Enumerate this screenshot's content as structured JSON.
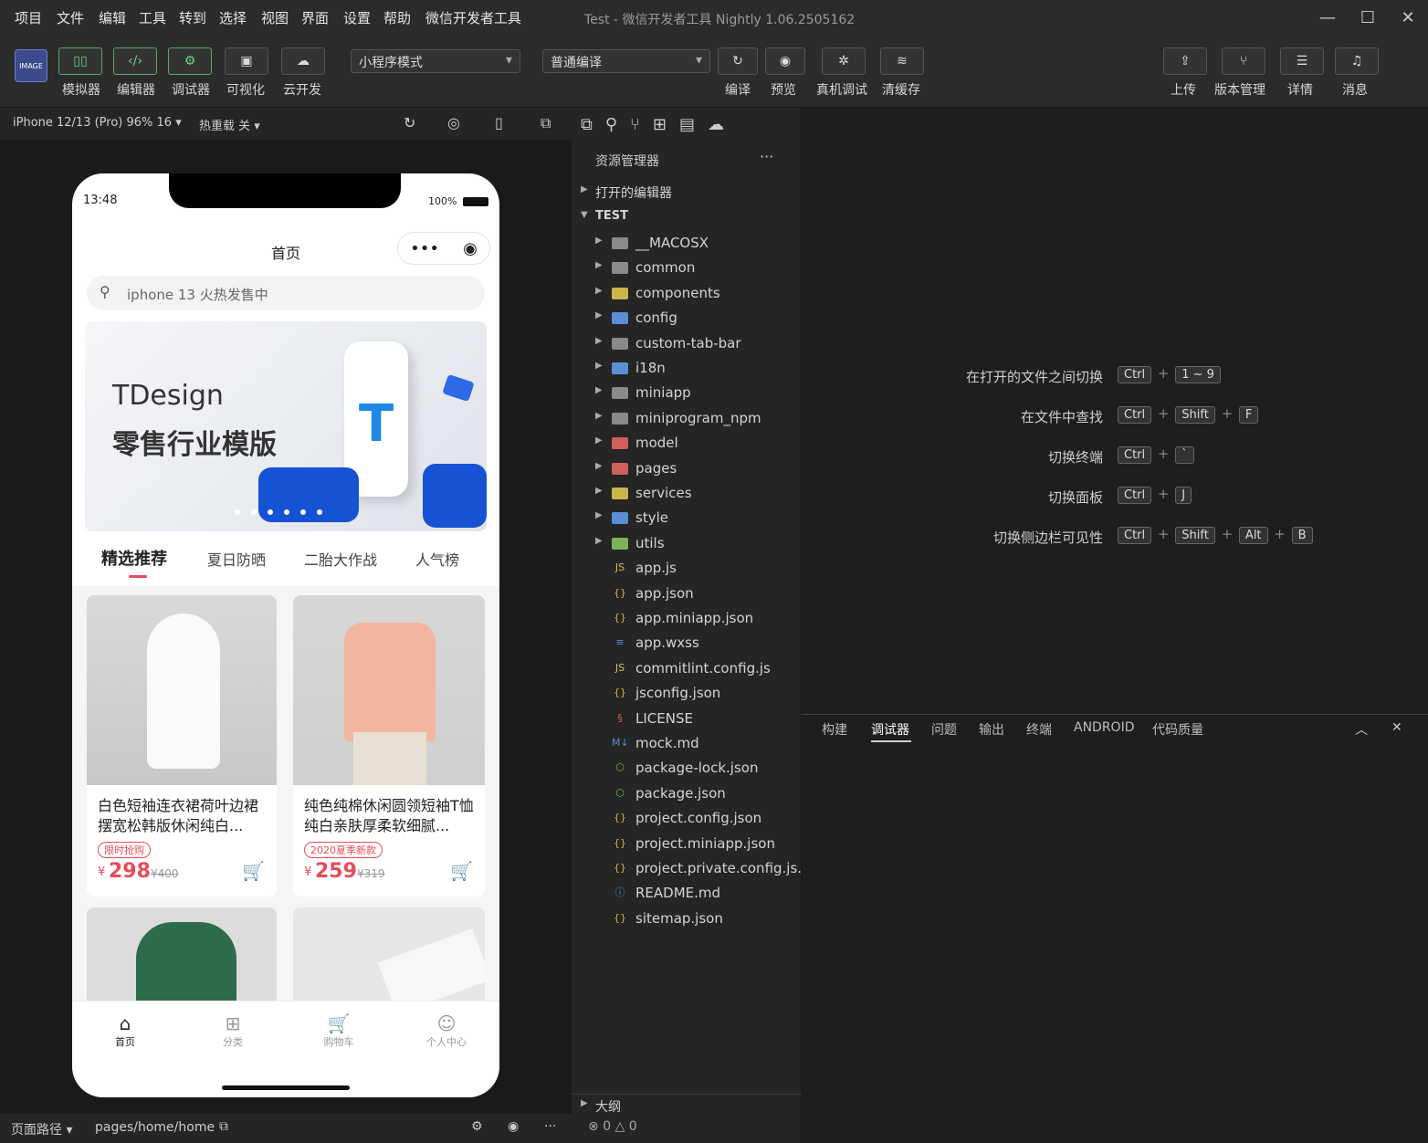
{
  "menu": [
    "项目",
    "文件",
    "编辑",
    "工具",
    "转到",
    "选择",
    "视图",
    "界面",
    "设置",
    "帮助",
    "微信开发者工具"
  ],
  "window_title": "Test - 微信开发者工具 Nightly 1.06.2505162",
  "toolbar": {
    "left_labels": [
      "模拟器",
      "编辑器",
      "调试器",
      "可视化",
      "云开发"
    ],
    "mode_select": "小程序模式",
    "compile_select": "普通编译",
    "mid_labels": [
      "编译",
      "预览",
      "真机调试",
      "清缓存"
    ],
    "right_labels": [
      "上传",
      "版本管理",
      "详情",
      "消息"
    ]
  },
  "simbar": {
    "device": "iPhone 12/13 (Pro) 96% 16",
    "hotreload": "热重载 关"
  },
  "phone": {
    "time": "13:48",
    "battery": "100%",
    "nav_title": "首页",
    "search_placeholder": "iphone 13 火热发售中",
    "banner_title": "TDesign",
    "banner_subtitle": "零售行业模版",
    "tabs": [
      "精选推荐",
      "夏日防晒",
      "二胎大作战",
      "人气榜"
    ],
    "products": [
      {
        "name": "白色短袖连衣裙荷叶边裙摆宽松韩版休闲纯白...",
        "tag": "限时抢购",
        "price": "298",
        "orig": "¥400"
      },
      {
        "name": "纯色纯棉休闲圆领短袖T恤纯白亲肤厚柔软细腻...",
        "tag": "2020夏季新款",
        "price": "259",
        "orig": "¥319"
      }
    ],
    "bottom_tabs": [
      "首页",
      "分类",
      "购物车",
      "个人中心"
    ],
    "currency": "¥"
  },
  "explorer": {
    "title": "资源管理器",
    "open_editors": "打开的编辑器",
    "root": "TEST",
    "items": [
      {
        "name": "__MACOSX",
        "type": "folder",
        "color": "#8a8a8a",
        "icon": "▬"
      },
      {
        "name": "common",
        "type": "folder",
        "color": "#8a8a8a",
        "icon": "▬"
      },
      {
        "name": "components",
        "type": "folder",
        "color": "#c9b54a",
        "icon": "▬"
      },
      {
        "name": "config",
        "type": "folder",
        "color": "#5b8fd6",
        "icon": "▬"
      },
      {
        "name": "custom-tab-bar",
        "type": "folder",
        "color": "#8a8a8a",
        "icon": "▬"
      },
      {
        "name": "i18n",
        "type": "folder",
        "color": "#5b8fd6",
        "icon": "▬"
      },
      {
        "name": "miniapp",
        "type": "folder",
        "color": "#8a8a8a",
        "icon": "▬"
      },
      {
        "name": "miniprogram_npm",
        "type": "folder",
        "color": "#8a8a8a",
        "icon": "▬"
      },
      {
        "name": "model",
        "type": "folder",
        "color": "#d0605a",
        "icon": "▬"
      },
      {
        "name": "pages",
        "type": "folder",
        "color": "#d0605a",
        "icon": "▬"
      },
      {
        "name": "services",
        "type": "folder",
        "color": "#c9b54a",
        "icon": "▬"
      },
      {
        "name": "style",
        "type": "folder",
        "color": "#5b8fd6",
        "icon": "▬"
      },
      {
        "name": "utils",
        "type": "folder",
        "color": "#7bb35b",
        "icon": "▬"
      },
      {
        "name": "app.js",
        "type": "file",
        "color": "#d6c24a",
        "icon": "JS"
      },
      {
        "name": "app.json",
        "type": "file",
        "color": "#c9b54a",
        "icon": "{}"
      },
      {
        "name": "app.miniapp.json",
        "type": "file",
        "color": "#c9b54a",
        "icon": "{}"
      },
      {
        "name": "app.wxss",
        "type": "file",
        "color": "#5b8fd6",
        "icon": "≡"
      },
      {
        "name": "commitlint.config.js",
        "type": "file",
        "color": "#d6c24a",
        "icon": "JS"
      },
      {
        "name": "jsconfig.json",
        "type": "file",
        "color": "#c9b54a",
        "icon": "{}"
      },
      {
        "name": "LICENSE",
        "type": "file",
        "color": "#d0605a",
        "icon": "§"
      },
      {
        "name": "mock.md",
        "type": "file",
        "color": "#5b8fd6",
        "icon": "M↓"
      },
      {
        "name": "package-lock.json",
        "type": "file",
        "color": "#7bb35b",
        "icon": "⬡"
      },
      {
        "name": "package.json",
        "type": "file",
        "color": "#7bb35b",
        "icon": "⬡"
      },
      {
        "name": "project.config.json",
        "type": "file",
        "color": "#c9b54a",
        "icon": "{}"
      },
      {
        "name": "project.miniapp.json",
        "type": "file",
        "color": "#c9b54a",
        "icon": "{}"
      },
      {
        "name": "project.private.config.js...",
        "type": "file",
        "color": "#c9b54a",
        "icon": "{}"
      },
      {
        "name": "README.md",
        "type": "file",
        "color": "#5b8fd6",
        "icon": "ⓘ"
      },
      {
        "name": "sitemap.json",
        "type": "file",
        "color": "#c9b54a",
        "icon": "{}"
      }
    ],
    "outline": "大纲",
    "errors": "0",
    "warnings": "0"
  },
  "shortcuts": [
    {
      "label": "在打开的文件之间切换",
      "keys": [
        "Ctrl",
        "1 ~ 9"
      ]
    },
    {
      "label": "在文件中查找",
      "keys": [
        "Ctrl",
        "Shift",
        "F"
      ]
    },
    {
      "label": "切换终端",
      "keys": [
        "Ctrl",
        "`"
      ]
    },
    {
      "label": "切换面板",
      "keys": [
        "Ctrl",
        "J"
      ]
    },
    {
      "label": "切换侧边栏可见性",
      "keys": [
        "Ctrl",
        "Shift",
        "Alt",
        "B"
      ]
    }
  ],
  "panel_tabs": [
    "构建",
    "调试器",
    "问题",
    "输出",
    "终端",
    "ANDROID",
    "代码质量"
  ],
  "status": {
    "path_label": "页面路径",
    "path": "pages/home/home"
  }
}
